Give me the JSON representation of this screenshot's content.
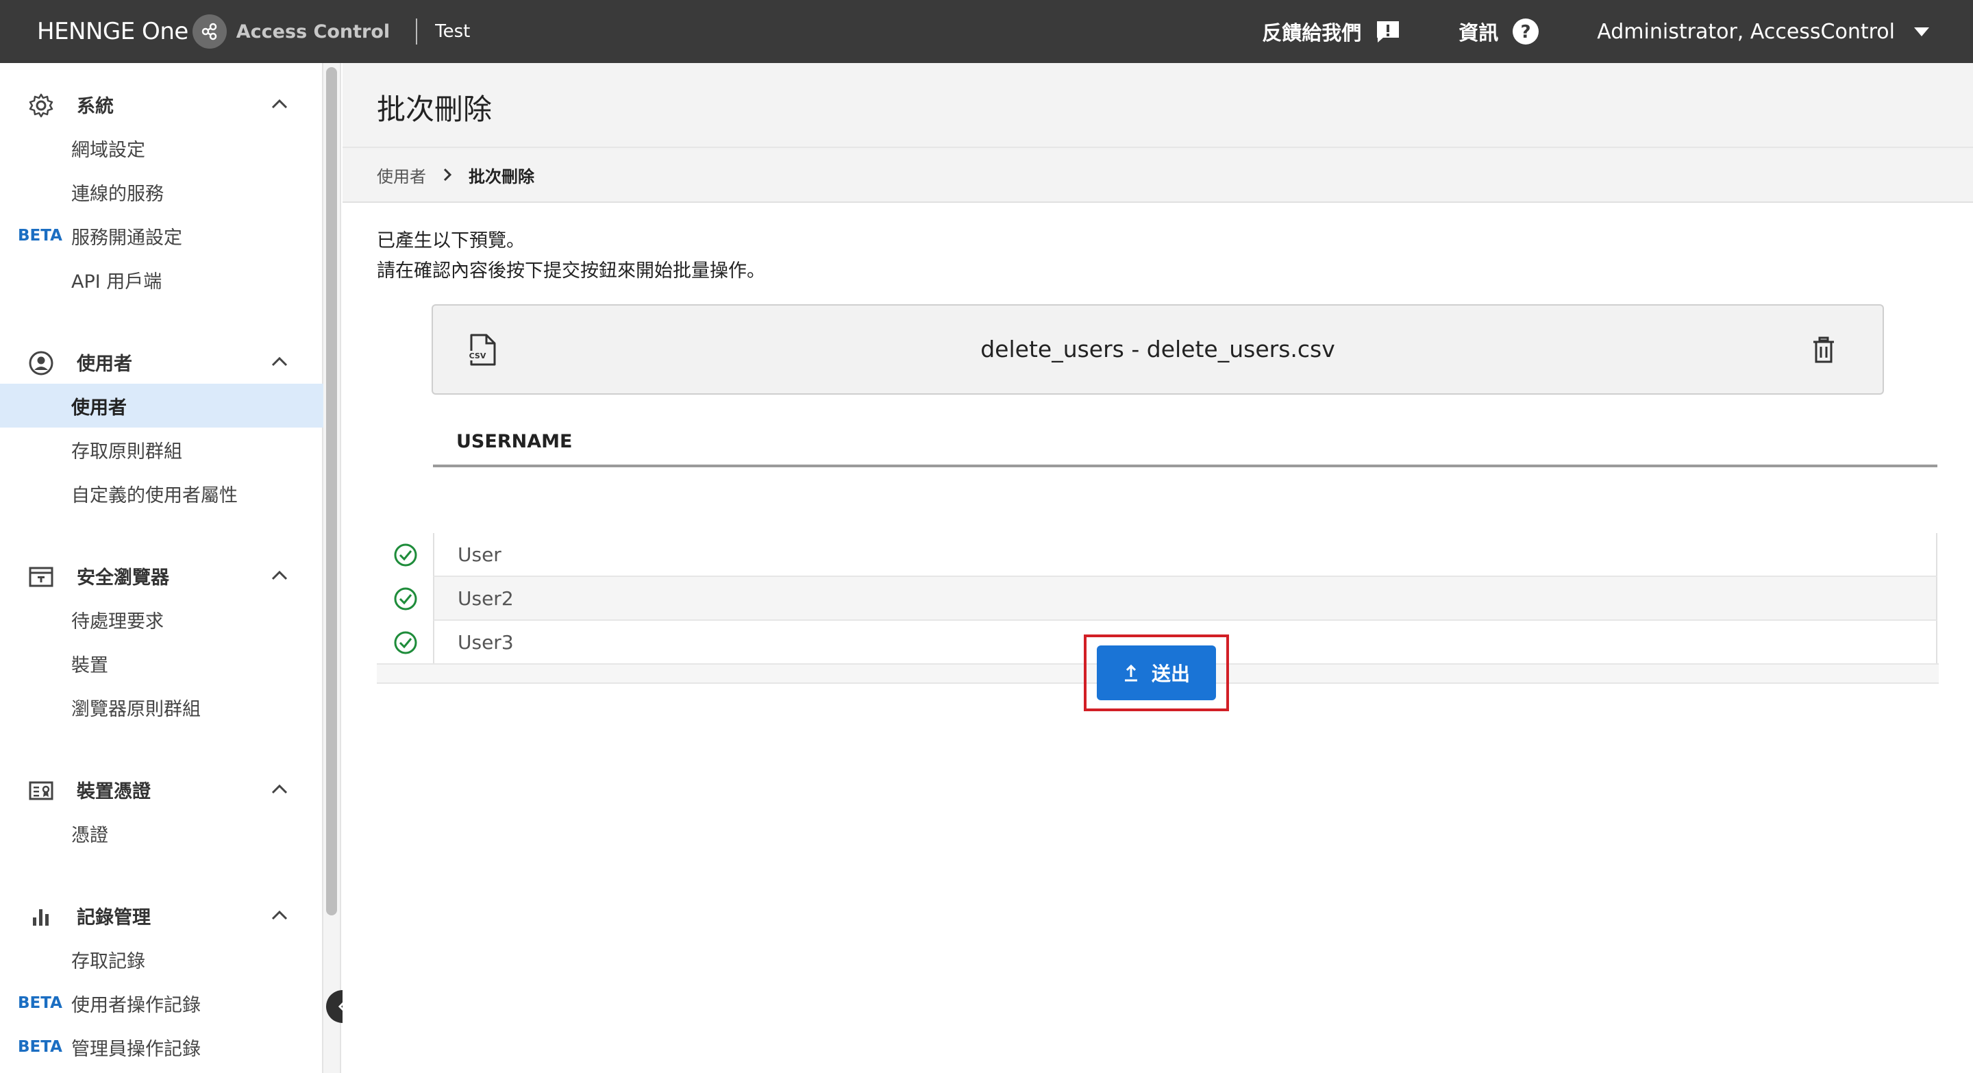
{
  "header": {
    "brand": "HENNGE One",
    "product": "Access Control",
    "tenant": "Test",
    "feedback_label": "反饋給我們",
    "info_label": "資訊",
    "user_label": "Administrator, AccessControl"
  },
  "sidebar": {
    "system": {
      "title": "系統",
      "items": [
        "網域設定",
        "連線的服務",
        "服務開通設定",
        "API 用戶端"
      ],
      "beta_item": "BETA"
    },
    "users": {
      "title": "使用者",
      "items": [
        "使用者",
        "存取原則群組",
        "自定義的使用者屬性"
      ]
    },
    "browser": {
      "title": "安全瀏覽器",
      "items": [
        "待處理要求",
        "裝置",
        "瀏覽器原則群組"
      ]
    },
    "device": {
      "title": "裝置憑證",
      "items": [
        "憑證"
      ]
    },
    "logs": {
      "title": "記錄管理",
      "items": [
        "存取記錄",
        "使用者操作記錄",
        "管理員操作記錄"
      ],
      "beta_a": "BETA",
      "beta_b": "BETA"
    }
  },
  "main": {
    "title": "批次刪除",
    "breadcrumb": {
      "parent": "使用者",
      "current": "批次刪除"
    },
    "intro_line1": "已產生以下預覽。",
    "intro_line2": "請在確認內容後按下提交按鈕來開始批量操作。",
    "file": {
      "name": "delete_users - delete_users.csv",
      "icon_text": "CSV"
    },
    "table": {
      "header": "USERNAME",
      "rows": [
        "User",
        "User2",
        "User3"
      ]
    },
    "submit_label": "送出"
  },
  "colors": {
    "accent": "#1a74d6",
    "header_bg": "#3a3a3a",
    "success": "#1e8c3a",
    "highlight": "#d21f26"
  }
}
